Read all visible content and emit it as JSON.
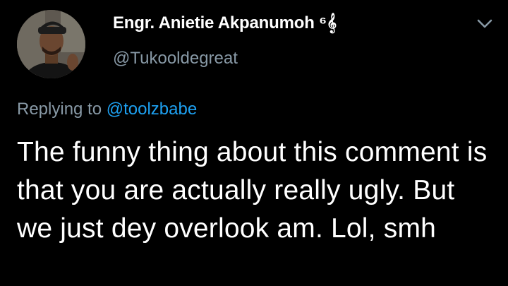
{
  "tweet": {
    "display_name": "Engr. Anietie Akpanumoh ⁶𝄞",
    "handle": "@Tukooldegreat",
    "reply_prefix": "Replying to ",
    "reply_mention": "@toolzbabe",
    "text": "The funny thing about this comment is that you are actually really ugly. But we just dey overlook am. Lol, smh"
  },
  "icons": {
    "avatar": "profile-photo",
    "menu": "chevron-down-icon"
  },
  "colors": {
    "background": "#000000",
    "text_primary": "#ffffff",
    "text_secondary": "#8899a6",
    "accent": "#1da1f2"
  }
}
